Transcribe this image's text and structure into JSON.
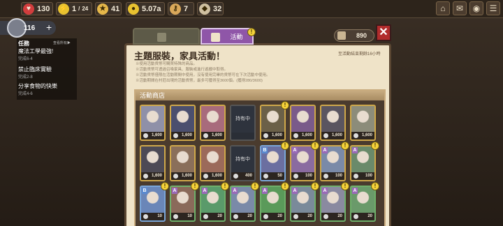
{
  "resources": [
    {
      "icon": "heart-icon",
      "value": "130",
      "color": "#d23d3d"
    },
    {
      "icon": "lightning-icon",
      "value": "1",
      "max": "24",
      "color": "#e8c230"
    },
    {
      "icon": "star-icon",
      "value": "41",
      "color": "#e6b84a"
    },
    {
      "icon": "coin-icon",
      "value": "5.07a",
      "color": "#e8c230"
    },
    {
      "icon": "key-icon",
      "value": "7",
      "color": "#d9a85a"
    },
    {
      "icon": "material-icon",
      "value": "32",
      "color": "#cfc0a0"
    }
  ],
  "top_buttons": [
    "home-icon",
    "mail-icon",
    "camera-icon",
    "menu-icon"
  ],
  "player": {
    "level": "116"
  },
  "tasks": {
    "title": "任務",
    "view_all": "查看所有▶",
    "items": [
      {
        "label": "魔法工學最強!",
        "sub": "完成6-4"
      },
      {
        "label": "禁止臨床實驗",
        "sub": "完成2-8"
      },
      {
        "label": "分享食物的快樂",
        "sub": "完成4-6"
      }
    ]
  },
  "tabs": [
    {
      "label": "",
      "active": false
    },
    {
      "label": "活動",
      "active": true
    }
  ],
  "currency": {
    "value": "890"
  },
  "event": {
    "title": "主題服裝，家具活動！",
    "remaining": "至活動結束剩餘16小時",
    "desc": [
      "※使用活動貨幣可購買特殊的商品。",
      "※活動貨幣可透過召喚家具、服裝或進行遊戲中取得。",
      "※活動貨幣僅限在活動期間中使用，沒有使用完畢的貨幣可在下次活動中使用。",
      "※活動期間在村莊出現的活動貨幣，最多可獲得至3600個。(獲得280/3600)"
    ]
  },
  "shop": {
    "title": "活動商店",
    "owned_label": "持有中",
    "rows": [
      [
        {
          "price": "1,600",
          "color": "#8f90a8"
        },
        {
          "price": "1,600",
          "color": "#4b4f6e"
        },
        {
          "price": "1,600",
          "color": "#a86b7c"
        },
        {
          "price": "",
          "color": "#2e333d",
          "owned": true
        },
        {
          "price": "1,600",
          "color": "#6b6048"
        },
        {
          "price": "1,600",
          "color": "#7a5a8a"
        },
        {
          "price": "1,600",
          "color": "#5a5560"
        },
        {
          "price": "1,600",
          "color": "#8c8c7a"
        }
      ],
      [
        {
          "price": "1,600",
          "color": "#4d4a55"
        },
        {
          "price": "1,600",
          "color": "#8a6f5a"
        },
        {
          "price": "1,600",
          "color": "#9b6a5a"
        },
        {
          "price": "400",
          "color": "#2e333d",
          "owned": true
        },
        {
          "price": "50",
          "color": "#6b6fa0",
          "grade": "B"
        },
        {
          "price": "100",
          "color": "#8a6ba0",
          "grade": "A"
        },
        {
          "price": "100",
          "color": "#7a8aa8",
          "grade": "A"
        },
        {
          "price": "100",
          "color": "#6a8a6a",
          "grade": "A"
        }
      ],
      [
        {
          "price": "10",
          "color": "#6a86b8",
          "grade": "B"
        },
        {
          "price": "10",
          "color": "#8a6a5a",
          "grade": "A"
        },
        {
          "price": "20",
          "color": "#5a9a6a",
          "grade": "A"
        },
        {
          "price": "20",
          "color": "#7a8aa8",
          "grade": "A"
        },
        {
          "price": "20",
          "color": "#5a9a5a",
          "grade": "A"
        },
        {
          "price": "20",
          "color": "#7a8a9a",
          "grade": "A"
        },
        {
          "price": "20",
          "color": "#8a8aa0",
          "grade": "A"
        },
        {
          "price": "20",
          "color": "#6a9a6a",
          "grade": "A"
        }
      ]
    ]
  }
}
